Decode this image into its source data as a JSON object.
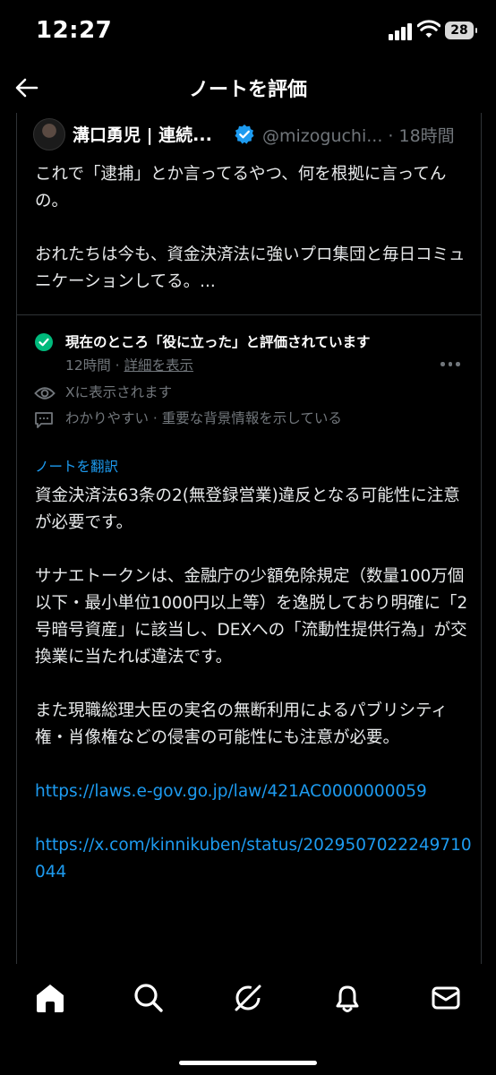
{
  "status_bar": {
    "time": "12:27",
    "battery": "28"
  },
  "header": {
    "title": "ノートを評価"
  },
  "post": {
    "author": "溝口勇児 | 連続...",
    "handle_time": "@mizoguchi... · 18時間",
    "paragraphs": [
      "これで「逮捕」とか言ってるやつ、何を根拠に言ってんの。",
      "おれたちは今も、資金決済法に強いプロ集団と毎日コミュニケーションしてる。..."
    ]
  },
  "note": {
    "status_title": "現在のところ「役に立った」と評価されています",
    "time": "12時間 · ",
    "details_link": "詳細を表示",
    "shown_on_x": "Xに表示されます",
    "reasons": "わかりやすい · 重要な背景情報を示している",
    "translate_link": "ノートを翻訳",
    "paragraphs": [
      "資金決済法63条の2(無登録営業)違反となる可能性に注意が必要です。",
      "サナエトークンは、金融庁の少額免除規定（数量100万個以下・最小単位1000円以上等）を逸脱しており明確に「2号暗号資産」に該当し、DEXへの「流動性提供行為」が交換業に当たれば違法です。",
      "また現職総理大臣の実名の無断利用によるパブリシティ権・肖像権などの侵害の可能性にも注意が必要。"
    ],
    "link1": "https://laws.e-gov.go.jp/law/421AC0000000059",
    "link2": "https://x.com/kinnikuben/status/2029507022249710044"
  },
  "tabbar": {
    "icons": [
      "home-icon",
      "search-icon",
      "grok-icon",
      "notifications-icon",
      "messages-icon"
    ]
  },
  "colors": {
    "accent": "#1d9bf0",
    "success": "#00ba7c",
    "muted": "#71767b",
    "border": "#2f3336"
  }
}
